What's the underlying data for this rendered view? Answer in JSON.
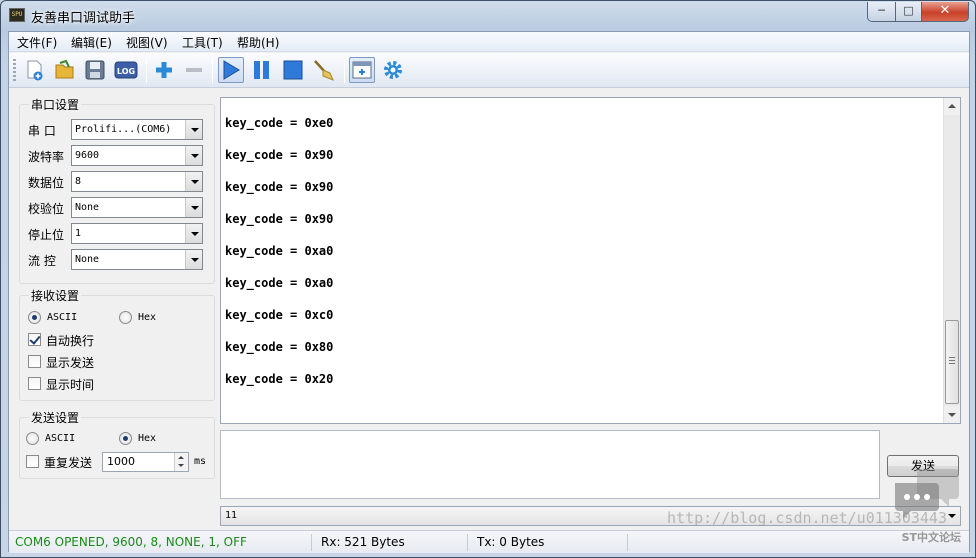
{
  "window": {
    "title": "友善串口调试助手",
    "app_icon": "SPU"
  },
  "caption_buttons": {
    "minimize": "─",
    "maximize": "□",
    "close": "✕"
  },
  "menu": [
    {
      "label": "文件(F)"
    },
    {
      "label": "编辑(E)"
    },
    {
      "label": "视图(V)"
    },
    {
      "label": "工具(T)"
    },
    {
      "label": "帮助(H)"
    }
  ],
  "toolbar": {
    "icons": [
      "new-icon",
      "open-icon",
      "save-icon",
      "log-icon",
      "add-icon",
      "remove-icon",
      "run-icon",
      "pause-icon",
      "stop-icon",
      "clear-icon",
      "new-window-icon",
      "settings-icon"
    ],
    "log_text": "LOG"
  },
  "serial_settings": {
    "title": "串口设置",
    "fields": [
      {
        "label": "串  口",
        "value": "Prolifi...(COM6)"
      },
      {
        "label": "波特率",
        "value": "9600"
      },
      {
        "label": "数据位",
        "value": "8"
      },
      {
        "label": "校验位",
        "value": "None"
      },
      {
        "label": "停止位",
        "value": "1"
      },
      {
        "label": "流  控",
        "value": "None"
      }
    ]
  },
  "receive_settings": {
    "title": "接收设置",
    "ascii": "ASCII",
    "hex": "Hex",
    "selected": "ASCII",
    "auto_newline": {
      "label": "自动换行",
      "checked": true
    },
    "show_send": {
      "label": "显示发送",
      "checked": false
    },
    "show_time": {
      "label": "显示时间",
      "checked": false
    }
  },
  "send_settings": {
    "title": "发送设置",
    "ascii": "ASCII",
    "hex": "Hex",
    "selected": "Hex",
    "repeat": {
      "label": "重复发送",
      "checked": false
    },
    "interval": "1000",
    "unit": "ms"
  },
  "receive_lines": [
    "key_code = 0xe0",
    "key_code = 0x90",
    "key_code = 0x90",
    "key_code = 0x90",
    "key_code = 0xa0",
    "key_code = 0xa0",
    "key_code = 0xc0",
    "key_code = 0x80",
    "key_code = 0x20"
  ],
  "send_input": "",
  "send_button": "发送",
  "history_value": "11",
  "status": {
    "port": "COM6 OPENED, 9600, 8, NONE, 1, OFF",
    "rx": "Rx: 521 Bytes",
    "tx": "Tx: 0 Bytes",
    "port_color": "#1a8a1a"
  },
  "watermark": {
    "url": "http://blog.csdn.net/u011303443",
    "tag": "ST中文论坛"
  }
}
